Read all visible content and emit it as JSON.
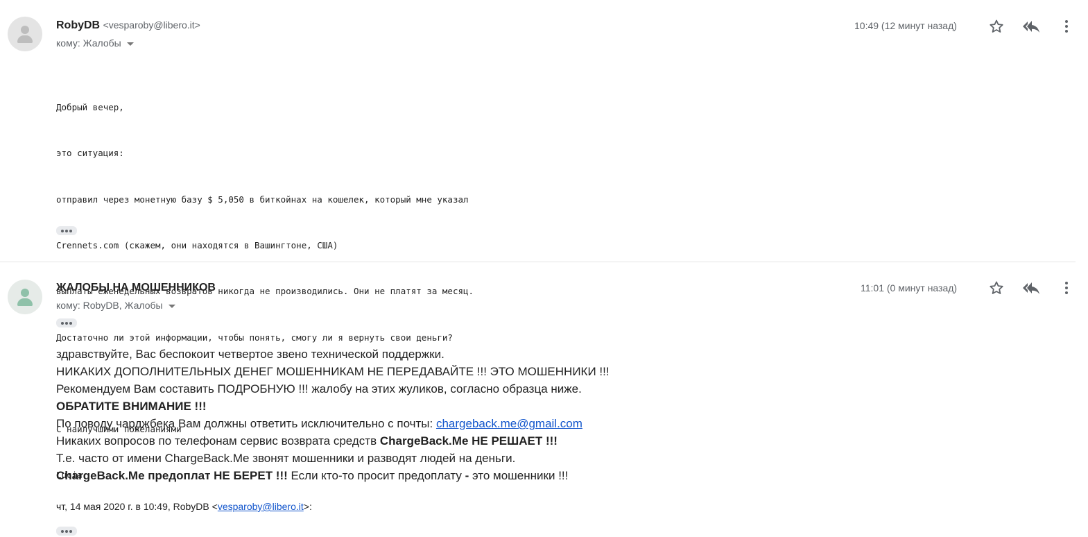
{
  "message1": {
    "sender_name": "RobyDB",
    "sender_email": "<vesparoby@libero.it>",
    "recipients": "кому: Жалобы",
    "time": "10:49 (12 минут назад)",
    "body_lines": [
      "Добрый вечер,",
      "это ситуация:",
      "отправил через монетную базу $ 5,050 в биткойнах на кошелек, который мне указал",
      "Crennets.com (скажем, они находятся в Вашингтоне, США)",
      "выплаты еженедельных возвратов никогда не производились. Они не платят за месяц.",
      "Достаточно ли этой информации, чтобы понять, смогу ли я вернуть свои деньги?",
      "",
      "С наилучшими пожеланиями",
      "Lucia"
    ]
  },
  "message2": {
    "sender_name": "ЖАЛОБЫ НА МОШЕННИКОВ",
    "recipients": "кому: RobyDB, Жалобы",
    "time": "11:01 (0 минут назад)",
    "line1": "здравствуйте, Вас беспокоит четвертое звено технической поддержки.",
    "line2": "НИКАКИХ ДОПОЛНИТЕЛЬНЫХ ДЕНЕГ МОШЕННИКАМ НЕ ПЕРЕДАВАЙТЕ !!! ЭТО МОШЕННИКИ !!!",
    "line3": "Рекомендуем Вам составить ПОДРОБНУЮ !!! жалобу на этих жуликов, согласно образца ниже.",
    "line4": "ОБРАТИТЕ ВНИМАНИЕ !!!",
    "line5_prefix": "По поводу чарджбека Вам должны ответить исключительно с почты: ",
    "line5_link": "chargeback.me@gmail.com",
    "line6_prefix": "Никаких вопросов по телефонам сервис возврата средств ",
    "line6_bold": "ChargeBack.Me НЕ РЕШАЕТ !!!",
    "line7": "Т.е. часто от имени ChargeBack.Me звонят мошенники и разводят людей на деньги.",
    "line8_bold": "ChargeBack.Me предоплат НЕ БЕРЕТ !!!",
    "line8_mid": " Если кто-то просит предоплату ",
    "line8_dash": "-",
    "line8_suffix": " это мошенники !!!",
    "quote_prefix": "чт, 14 мая 2020 г. в 10:49, RobyDB <",
    "quote_link": "vesparoby@libero.it",
    "quote_suffix": ">:"
  },
  "icons": {
    "avatar": "person-icon",
    "star": "star-icon",
    "reply": "reply-all-icon",
    "more": "more-vertical-icon",
    "expand": "expand-dots-icon"
  },
  "colors": {
    "link": "#1155cc",
    "secondary_text": "#5f6368",
    "avatar_green": "#8fc1a9"
  }
}
